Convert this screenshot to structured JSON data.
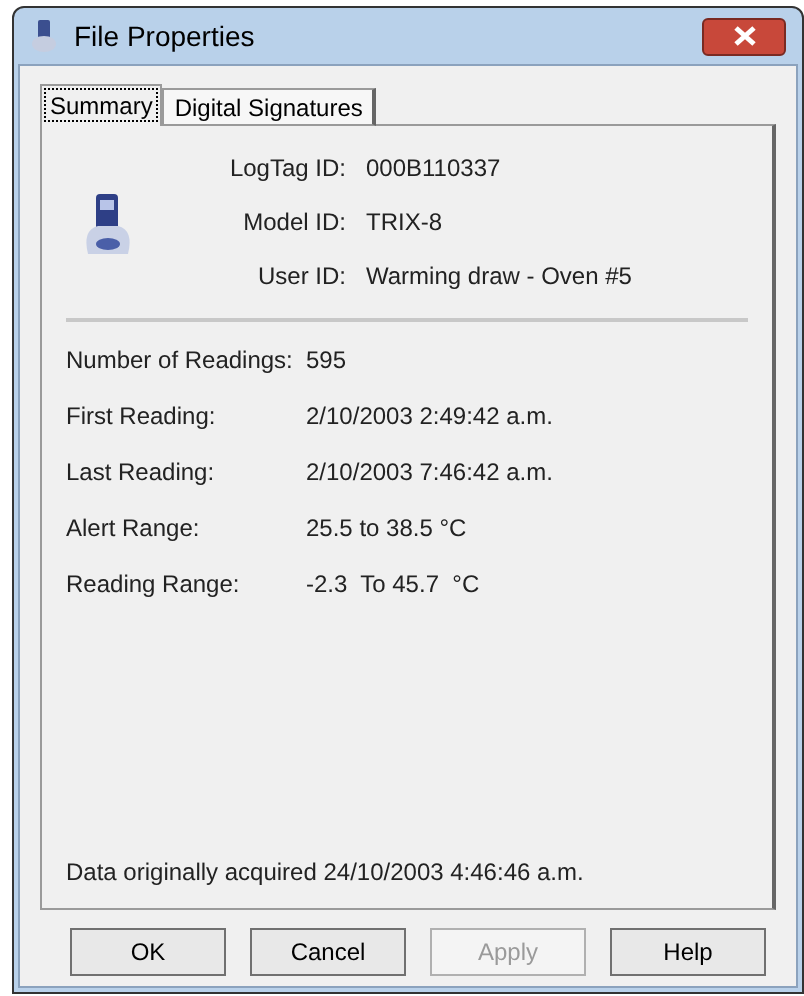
{
  "window": {
    "title": "File Properties"
  },
  "tabs": [
    {
      "label": "Summary",
      "selected": true
    },
    {
      "label": "Digital Signatures",
      "selected": false
    }
  ],
  "device_fields": [
    {
      "label": "LogTag ID:",
      "value": "000B110337"
    },
    {
      "label": "Model ID:",
      "value": "TRIX-8"
    },
    {
      "label": "User ID:",
      "value": "Warming draw - Oven #5"
    }
  ],
  "readings": [
    {
      "label": "Number of Readings:",
      "value": "595"
    },
    {
      "label": "First Reading:",
      "value": "2/10/2003 2:49:42 a.m."
    },
    {
      "label": "Last Reading:",
      "value": "2/10/2003 7:46:42 a.m."
    },
    {
      "label": "Alert Range:",
      "value": "25.5 to 38.5 °C"
    },
    {
      "label": "Reading Range:",
      "value": "-2.3  To 45.7  °C"
    }
  ],
  "footer_note": "Data originally acquired 24/10/2003 4:46:46 a.m.",
  "buttons": [
    {
      "label": "OK",
      "disabled": false
    },
    {
      "label": "Cancel",
      "disabled": false
    },
    {
      "label": "Apply",
      "disabled": true
    },
    {
      "label": "Help",
      "disabled": false
    }
  ]
}
